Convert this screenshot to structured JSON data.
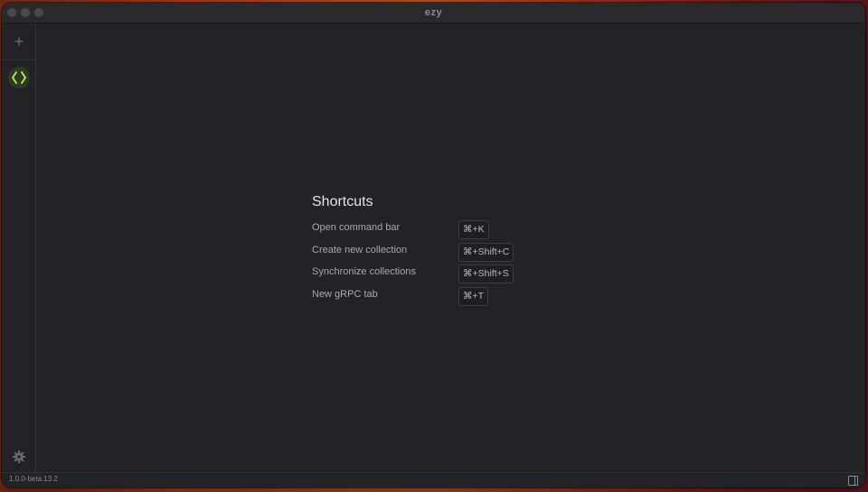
{
  "window": {
    "title": "ezy"
  },
  "sidebar": {
    "add_label": "+",
    "active_item": "grpc-collections",
    "accent_color": "#c7e85a"
  },
  "shortcuts": {
    "title": "Shortcuts",
    "items": [
      {
        "label": "Open command bar",
        "keys": "⌘+K"
      },
      {
        "label": "Create new collection",
        "keys": "⌘+Shift+C"
      },
      {
        "label": "Synchronize collections",
        "keys": "⌘+Shift+S"
      },
      {
        "label": "New gRPC tab",
        "keys": "⌘+T"
      }
    ]
  },
  "statusbar": {
    "version": "1.0.0-beta.13.2"
  }
}
